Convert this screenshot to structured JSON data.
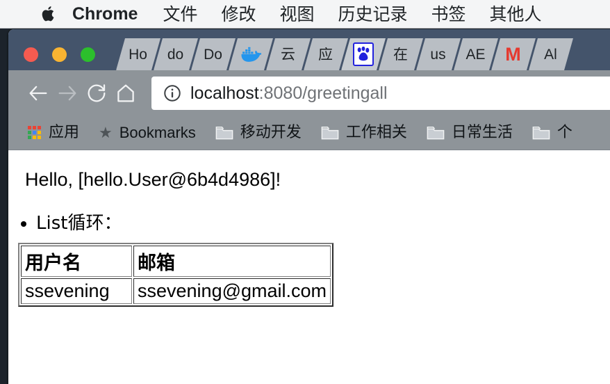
{
  "menubar": {
    "apple_icon": "apple-logo",
    "items": [
      {
        "label": "Chrome",
        "bold": true
      },
      {
        "label": "文件",
        "bold": false
      },
      {
        "label": "修改",
        "bold": false
      },
      {
        "label": "视图",
        "bold": false
      },
      {
        "label": "历史记录",
        "bold": false
      },
      {
        "label": "书签",
        "bold": false
      },
      {
        "label": "其他人",
        "bold": false
      }
    ]
  },
  "window": {
    "controls": [
      "close-red",
      "minimize-yellow",
      "maximize-green"
    ],
    "tabs": [
      {
        "label": "Ho",
        "type": "text",
        "active": false
      },
      {
        "label": "do",
        "type": "text",
        "active": false
      },
      {
        "label": "Do",
        "type": "text",
        "active": false
      },
      {
        "label": "",
        "type": "docker-icon",
        "active": false
      },
      {
        "label": "云",
        "type": "text",
        "active": false
      },
      {
        "label": "应",
        "type": "text",
        "active": false
      },
      {
        "label": "",
        "type": "baidu-icon",
        "active": true
      },
      {
        "label": "在",
        "type": "text",
        "active": false
      },
      {
        "label": "us",
        "type": "text",
        "active": false
      },
      {
        "label": "AE",
        "type": "text",
        "active": false
      },
      {
        "label": "",
        "type": "gmail-icon",
        "active": false
      },
      {
        "label": "Al",
        "type": "text",
        "active": false
      }
    ]
  },
  "toolbar": {
    "back_label": "back-arrow",
    "forward_label": "forward-arrow",
    "reload_label": "reload-arrow",
    "home_label": "home-house",
    "url_host": "localhost",
    "url_rest": ":8080/greetingall",
    "security_icon": "info-circle"
  },
  "bookmarks": [
    {
      "label": "应用",
      "icon": "apps-grid-icon",
      "cjk": true
    },
    {
      "label": "Bookmarks",
      "icon": "star-icon",
      "cjk": false
    },
    {
      "label": "移动开发",
      "icon": "folder-icon",
      "cjk": true
    },
    {
      "label": "工作相关",
      "icon": "folder-icon",
      "cjk": true
    },
    {
      "label": "日常生活",
      "icon": "folder-icon",
      "cjk": true
    },
    {
      "label": "个",
      "icon": "folder-icon",
      "cjk": true
    }
  ],
  "page": {
    "greeting": "Hello, [hello.User@6b4d4986]!",
    "list_heading": "List循环：",
    "table": {
      "headers": [
        "用户名",
        "邮箱"
      ],
      "rows": [
        {
          "username": "ssevening",
          "email": "ssevening@gmail.com"
        }
      ]
    }
  },
  "colors": {
    "menubar_bg": "#f4f5f6",
    "titlebar_bg": "#44546b",
    "toolbar_bg": "#8e9499",
    "tab_bg": "#b9bec4",
    "tab_active_bg": "#c6cbd0",
    "traffic_red": "#f65b50",
    "traffic_yellow": "#f9b432",
    "traffic_green": "#2cbf2c",
    "gmail_red": "#e5392f",
    "baidu_blue": "#2222dd",
    "docker_blue": "#2496ed",
    "desktop_bg": "#1c232b"
  }
}
